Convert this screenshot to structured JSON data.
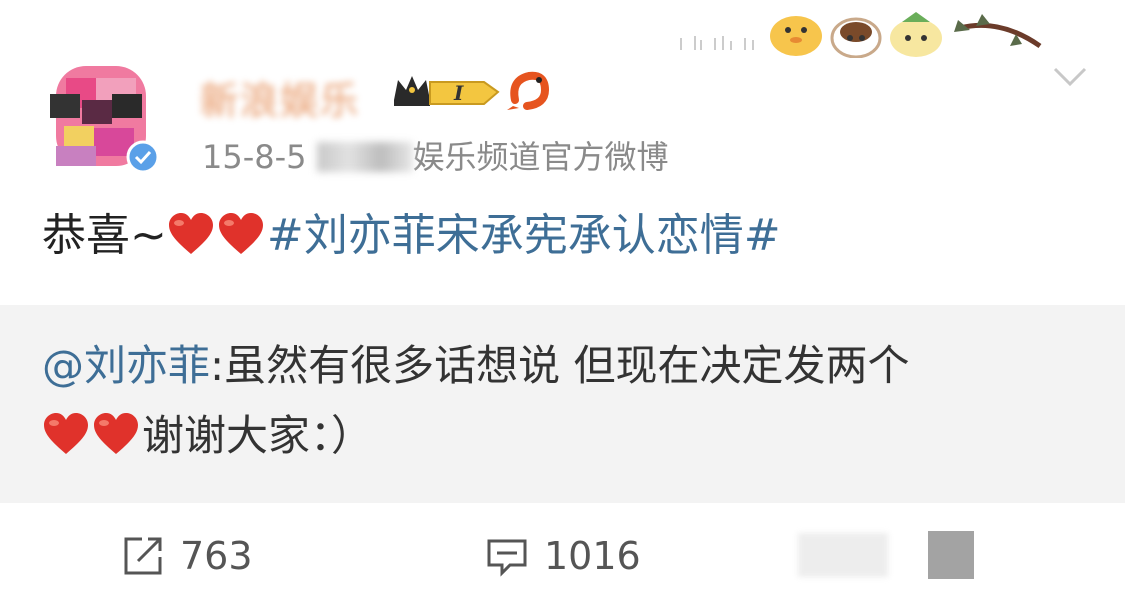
{
  "post": {
    "author": "新浪娱乐",
    "level_badge": "I",
    "date": "15-8-5",
    "source_suffix": "娱乐频道官方微博",
    "text_prefix": "恭喜~",
    "hashtag": "#刘亦菲宋承宪承认恋情#"
  },
  "repost": {
    "mention": "@刘亦菲",
    "line1_text": ":虽然有很多话想说 但现在决定发两个",
    "line2_text": "谢谢大家：）"
  },
  "actions": {
    "repost_count": "763",
    "comment_count": "1016"
  },
  "colors": {
    "link": "#3e6e96",
    "heart": "#e0322b",
    "meta": "#8a8a8a",
    "repost_bg": "#f3f3f3"
  },
  "icons": [
    "chevron-down-icon",
    "verified-badge-icon",
    "crown-level-icon",
    "shrimp-icon",
    "heart-icon",
    "repost-icon",
    "comment-icon"
  ]
}
